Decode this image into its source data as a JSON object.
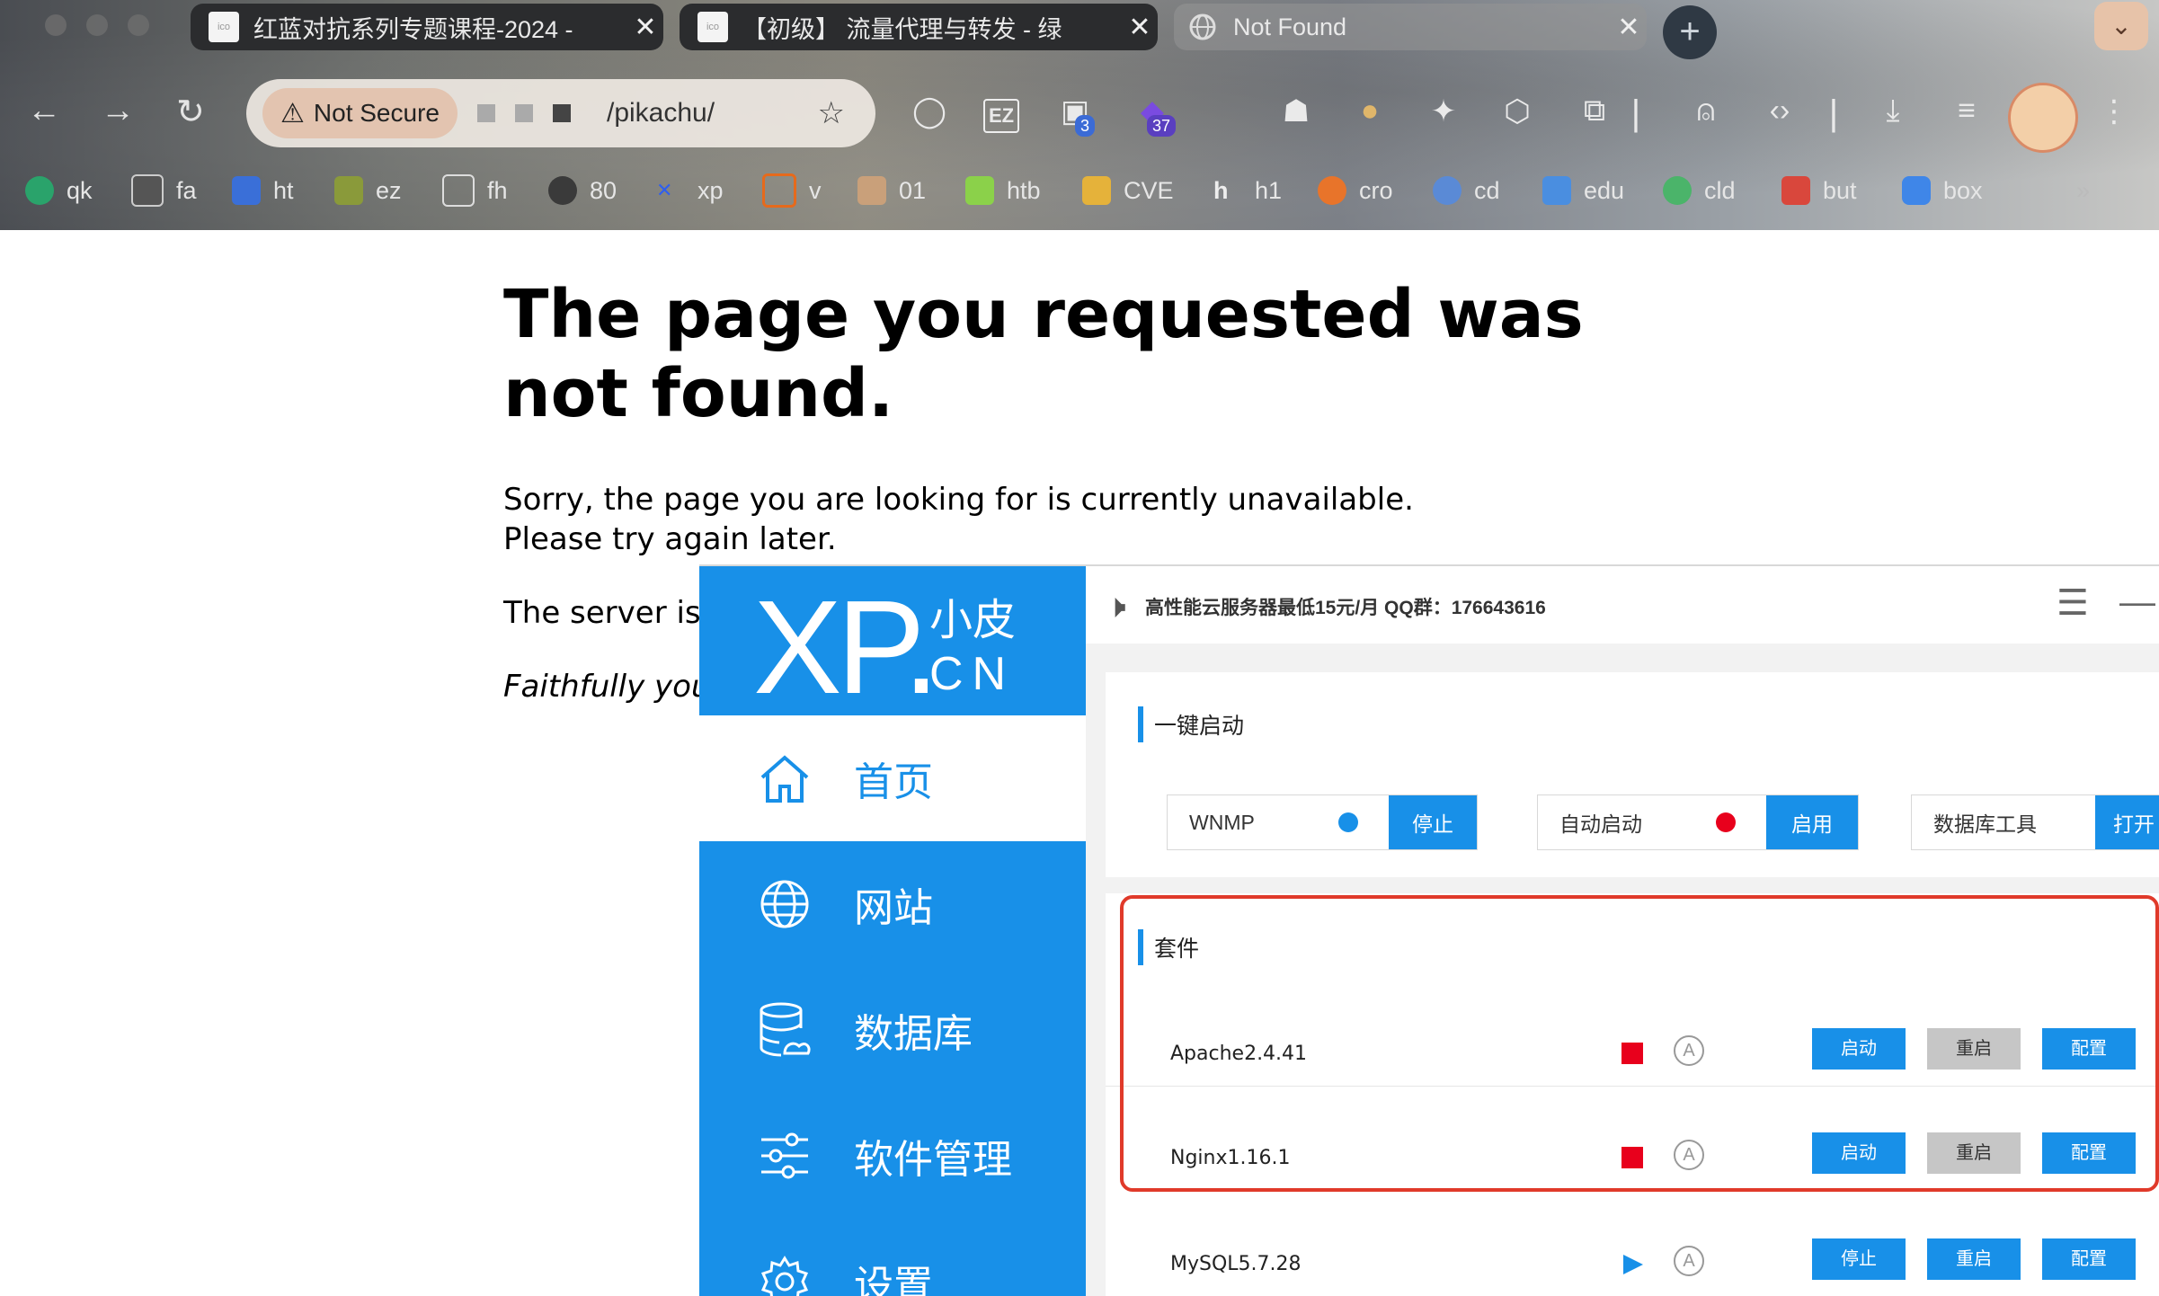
{
  "browser": {
    "tabs": [
      {
        "title": "红蓝对抗系列专题课程-2024 -",
        "favicon": "ico"
      },
      {
        "title": "【初级】 流量代理与转发 - 绿",
        "favicon": "ico"
      },
      {
        "title": "Not Found",
        "favicon": "globe-icon"
      }
    ],
    "new_tab": "+",
    "tab_menu": "⌄",
    "security_label": "Not Secure",
    "url": "/pikachu/",
    "toolbar_badges": {
      "ext_a": "3",
      "ext_b": "37"
    },
    "bookmarks": [
      "qk",
      "fa",
      "ht",
      "ez",
      "fh",
      "80",
      "xp",
      "v",
      "01",
      "htb",
      "CVE",
      "h1",
      "cro",
      "cd",
      "edu",
      "cld",
      "but",
      "box"
    ],
    "bookmarks_more": "»"
  },
  "page": {
    "title": "The page you requested was not found.",
    "line1": "Sorry, the page you are looking for is currently unavailable.",
    "line2": "Please try again later.",
    "line3": "The server is",
    "line4": "Faithfully you"
  },
  "xp": {
    "logo_big": "XP.",
    "logo_zh": "小皮",
    "logo_cn": "CN",
    "notice": "高性能云服务器最低15元/月  QQ群：176643616",
    "nav": [
      {
        "label": "首页",
        "icon": "home-icon",
        "selected": true
      },
      {
        "label": "网站",
        "icon": "globe-icon",
        "selected": false
      },
      {
        "label": "数据库",
        "icon": "database-icon",
        "selected": false
      },
      {
        "label": "软件管理",
        "icon": "sliders-icon",
        "selected": false
      },
      {
        "label": "设置",
        "icon": "gear-icon",
        "selected": false
      }
    ],
    "quick_start": {
      "title": "一键启动",
      "controls": [
        {
          "label": "WNMP",
          "dot": "#1890e8",
          "button": "停止"
        },
        {
          "label": "自动启动",
          "dot": "#e8001c",
          "button": "启用"
        },
        {
          "label": "数据库工具",
          "dot": "",
          "button": "打开"
        }
      ]
    },
    "suite": {
      "title": "套件",
      "rows": [
        {
          "name": "Apache2.4.41",
          "status": "stopped",
          "auto": "A",
          "actions": [
            "启动",
            "重启",
            "配置"
          ]
        },
        {
          "name": "Nginx1.16.1",
          "status": "stopped",
          "auto": "A",
          "actions": [
            "启动",
            "重启",
            "配置"
          ]
        },
        {
          "name": "MySQL5.7.28",
          "status": "running",
          "auto": "A",
          "actions": [
            "停止",
            "重启",
            "配置"
          ]
        }
      ]
    },
    "colors": {
      "accent": "#1890e8",
      "stopped": "#e8001c",
      "highlight": "#e03a2a"
    }
  }
}
